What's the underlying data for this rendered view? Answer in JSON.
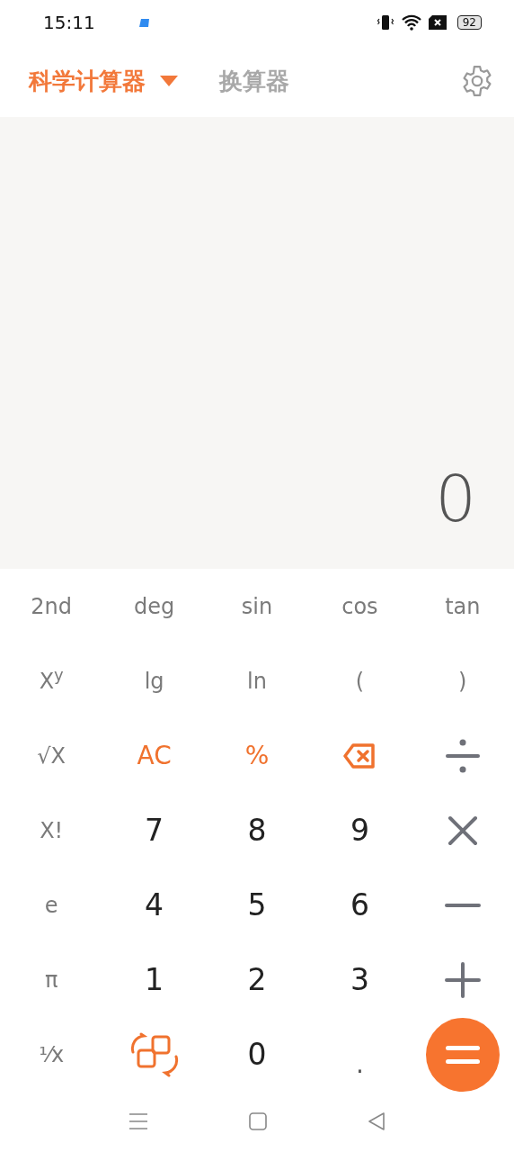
{
  "status_bar": {
    "time": "15:11",
    "battery": "92"
  },
  "tabs": [
    {
      "label": "科学计算器",
      "selected": true
    },
    {
      "label": "换算器",
      "selected": false
    }
  ],
  "display": {
    "value": "0"
  },
  "keys": [
    {
      "kind": "fn",
      "label": "2nd"
    },
    {
      "kind": "fn",
      "label": "deg"
    },
    {
      "kind": "fn",
      "label": "sin"
    },
    {
      "kind": "fn",
      "label": "cos"
    },
    {
      "kind": "fn",
      "label": "tan"
    },
    {
      "kind": "fn",
      "label": "X$^{y}$"
    },
    {
      "kind": "fn",
      "label": "lg"
    },
    {
      "kind": "fn",
      "label": "ln"
    },
    {
      "kind": "fn",
      "label": "("
    },
    {
      "kind": "fn",
      "label": ")"
    },
    {
      "kind": "fn",
      "label": "√X"
    },
    {
      "kind": "accent",
      "label": "AC"
    },
    {
      "kind": "accent",
      "label": "%"
    },
    {
      "kind": "backspace"
    },
    {
      "kind": "divide"
    },
    {
      "kind": "fn",
      "label": "X!"
    },
    {
      "kind": "num",
      "label": "7"
    },
    {
      "kind": "num",
      "label": "8"
    },
    {
      "kind": "num",
      "label": "9"
    },
    {
      "kind": "times"
    },
    {
      "kind": "fn",
      "label": "e"
    },
    {
      "kind": "num",
      "label": "4"
    },
    {
      "kind": "num",
      "label": "5"
    },
    {
      "kind": "num",
      "label": "6"
    },
    {
      "kind": "minus"
    },
    {
      "kind": "fn",
      "label": "π"
    },
    {
      "kind": "num",
      "label": "1"
    },
    {
      "kind": "num",
      "label": "2"
    },
    {
      "kind": "num",
      "label": "3"
    },
    {
      "kind": "plus"
    },
    {
      "kind": "fn",
      "label": "¹⁄x"
    },
    {
      "kind": "swap"
    },
    {
      "kind": "num",
      "label": "0"
    },
    {
      "kind": "dot",
      "label": "."
    },
    {
      "kind": "equals"
    }
  ]
}
